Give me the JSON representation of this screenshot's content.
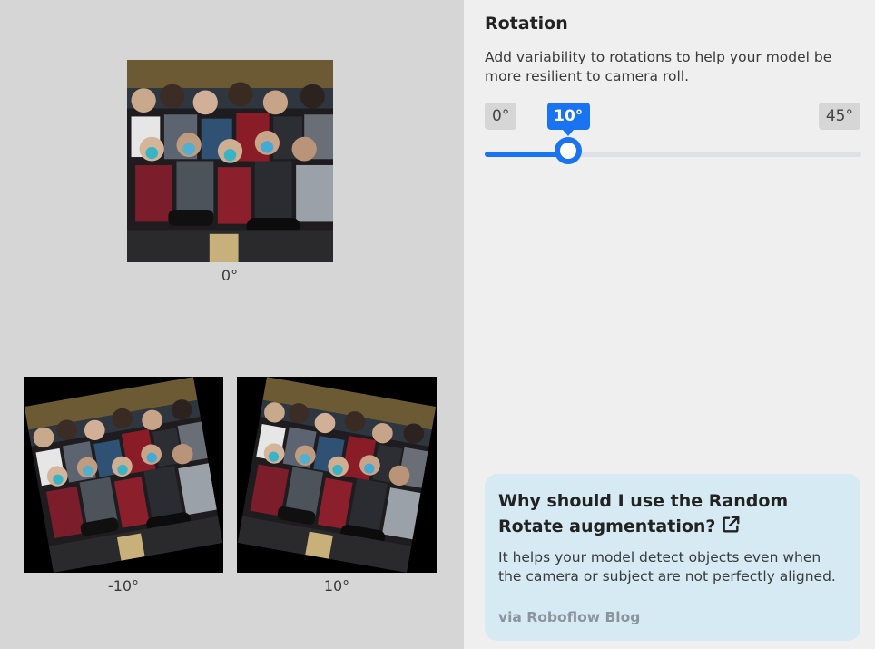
{
  "rotation": {
    "title": "Rotation",
    "description": "Add variability to rotations to help your model be more resilient to camera roll.",
    "slider": {
      "min_label": "0°",
      "max_label": "45°",
      "value_label": "10°",
      "min": 0,
      "max": 45,
      "value": 10
    }
  },
  "previews": [
    {
      "caption": "0°"
    },
    {
      "caption": "-10°"
    },
    {
      "caption": "10°"
    }
  ],
  "info": {
    "title": "Why should I use the Random Rotate augmentation?",
    "body": "It helps your model detect objects even when the camera or subject are not perfectly aligned.",
    "source": "via Roboflow Blog"
  },
  "colors": {
    "accent": "#1a73f0",
    "info_bg": "#d5eaf3",
    "preview_bg": "#d6d6d6"
  }
}
